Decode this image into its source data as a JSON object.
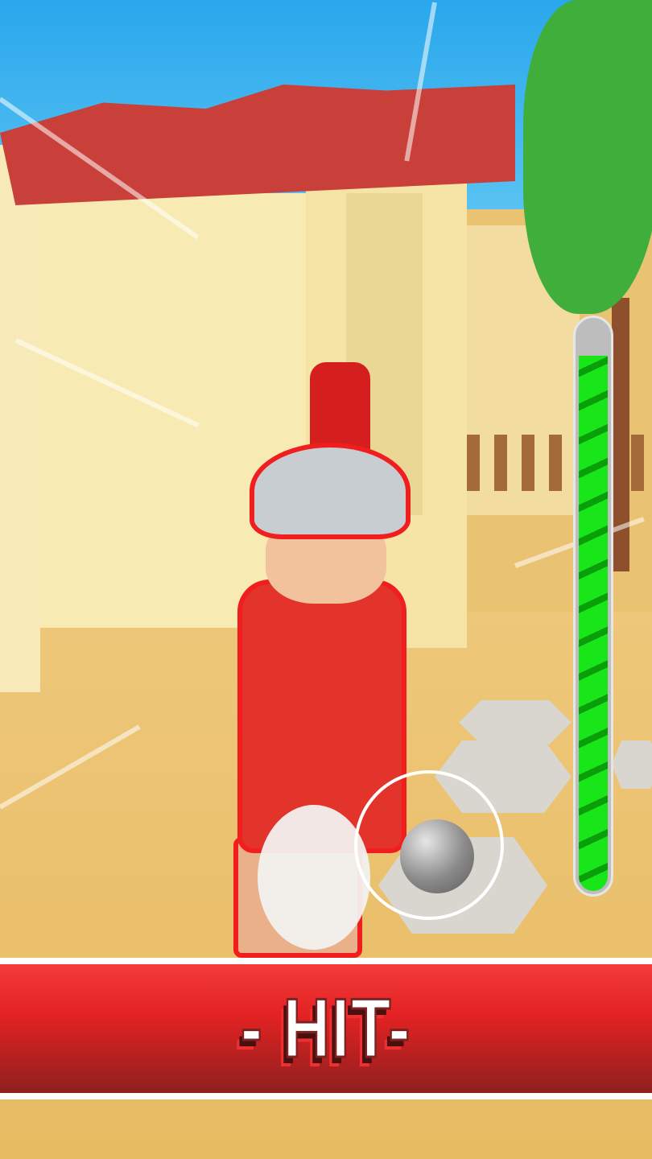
{
  "feedback": {
    "banner_text": "- HIT-"
  },
  "power_meter": {
    "fill_fraction": 0.94,
    "color": "#19e619"
  },
  "colors": {
    "banner": "#e32222",
    "outline": "#f01e1e"
  }
}
